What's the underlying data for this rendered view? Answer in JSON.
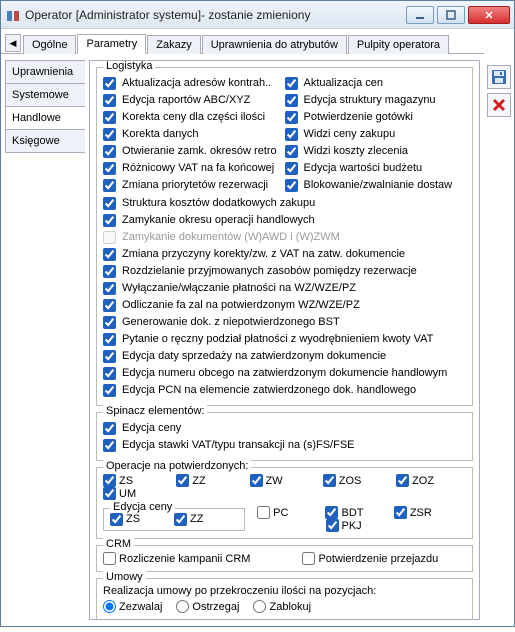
{
  "window": {
    "title": "Operator [Administrator systemu]- zostanie zmieniony"
  },
  "tabs": {
    "left_arrow": "◀",
    "right_arrow": "▶",
    "items": [
      "Ogólne",
      "Parametry",
      "Zakazy",
      "Uprawnienia do atrybutów",
      "Pulpity operatora"
    ],
    "active": 1
  },
  "vtabs": {
    "items": [
      "Uprawnienia",
      "Systemowe",
      "Handlowe",
      "Księgowe"
    ],
    "active": 2
  },
  "logistyka": {
    "title": "Logistyka",
    "col1": [
      "Aktualizacja adresów kontrah..",
      "Edycja raportów ABC/XYZ",
      "Korekta ceny dla części ilości",
      "Korekta danych",
      "Otwieranie zamk. okresów retro",
      "Różnicowy VAT na fa końcowej",
      "Zmiana priorytetów rezerwacji"
    ],
    "col2": [
      "Aktualizacja cen",
      "Edycja struktury magazynu",
      "Potwierdzenie gotówki",
      "Widzi ceny zakupu",
      "Widzi koszty zlecenia",
      "Edycja wartości budżetu",
      "Blokowanie/zwalnianie dostaw"
    ],
    "full": [
      {
        "label": "Struktura kosztów dodatkowych zakupu",
        "checked": true,
        "enabled": true
      },
      {
        "label": "Zamykanie okresu operacji handlowych",
        "checked": true,
        "enabled": true
      },
      {
        "label": "Zamykanie dokumentów (W)AWD i (W)ZWM",
        "checked": false,
        "enabled": false
      },
      {
        "label": "Zmiana przyczyny korekty/zw. z VAT na zatw. dokumencie",
        "checked": true,
        "enabled": true
      },
      {
        "label": "Rozdzielanie przyjmowanych zasobów pomiędzy rezerwacje",
        "checked": true,
        "enabled": true
      },
      {
        "label": "Wyłączanie/włączanie płatności na WZ/WZE/PZ",
        "checked": true,
        "enabled": true
      },
      {
        "label": "Odliczanie fa zal na potwierdzonym WZ/WZE/PZ",
        "checked": true,
        "enabled": true
      },
      {
        "label": "Generowanie dok. z niepotwierdzonego BST",
        "checked": true,
        "enabled": true
      },
      {
        "label": "Pytanie o ręczny podział płatności z wyodrębnieniem kwoty VAT",
        "checked": true,
        "enabled": true
      },
      {
        "label": "Edycja daty sprzedaży na zatwierdzonym dokumencie",
        "checked": true,
        "enabled": true
      },
      {
        "label": "Edycja numeru obcego na zatwierdzonym dokumencie handlowym",
        "checked": true,
        "enabled": true
      },
      {
        "label": "Edycja PCN na elemencie zatwierdzonego dok. handlowego",
        "checked": true,
        "enabled": true
      }
    ]
  },
  "spinacz": {
    "title": "Spinacz elementów:",
    "items": [
      {
        "label": "Edycja ceny",
        "checked": true
      },
      {
        "label": "Edycja stawki VAT/typu transakcji na (s)FS/FSE",
        "checked": true
      }
    ]
  },
  "operacje": {
    "title": "Operacje na potwierdzonych:",
    "row1": [
      {
        "label": "ZS",
        "checked": true
      },
      {
        "label": "ZZ",
        "checked": true
      },
      {
        "label": "ZW",
        "checked": true
      },
      {
        "label": "ZOS",
        "checked": true
      },
      {
        "label": "ZOZ",
        "checked": true
      },
      {
        "label": "UM",
        "checked": true
      }
    ],
    "edycja_ceny_title": "Edycja ceny",
    "row2_sub": [
      {
        "label": "ZS",
        "checked": true
      },
      {
        "label": "ZZ",
        "checked": true
      }
    ],
    "row2_rest": [
      {
        "label": "PC",
        "checked": false
      },
      {
        "label": "BDT",
        "checked": true
      },
      {
        "label": "ZSR",
        "checked": true
      },
      {
        "label": "PKJ",
        "checked": true
      }
    ]
  },
  "crm": {
    "title": "CRM",
    "items": [
      {
        "label": "Rozliczenie kampanii CRM",
        "checked": false
      },
      {
        "label": "Potwierdzenie przejazdu",
        "checked": false
      }
    ]
  },
  "umowy": {
    "title": "Umowy",
    "radio_label": "Realizacja umowy po przekroczeniu ilości na pozycjach:",
    "options": [
      {
        "label": "Zezwalaj",
        "selected": true
      },
      {
        "label": "Ostrzegaj",
        "selected": false
      },
      {
        "label": "Zablokuj",
        "selected": false
      }
    ]
  },
  "icons": {
    "save": "save-icon",
    "delete": "delete-icon"
  }
}
